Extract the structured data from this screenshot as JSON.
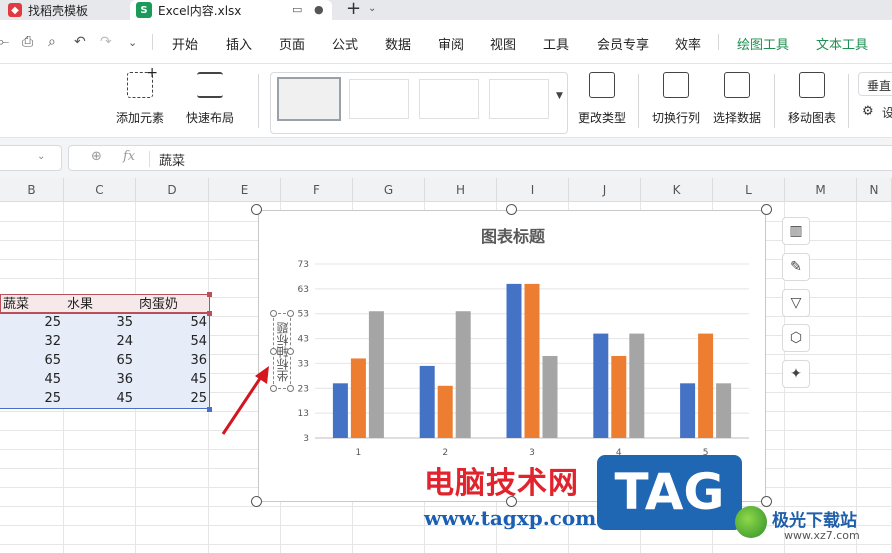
{
  "tabs": {
    "doc_tab": "找稻壳模板",
    "excel_tab": "Excel内容.xlsx"
  },
  "menu": {
    "items": [
      "开始",
      "插入",
      "页面",
      "公式",
      "数据",
      "审阅",
      "视图",
      "工具",
      "会员专享",
      "效率"
    ],
    "context_items": [
      "绘图工具",
      "文本工具"
    ]
  },
  "ribbon": {
    "add_element": "添加元素",
    "quick_layout": "快速布局",
    "change_type": "更改类型",
    "switch_rowcol": "切换行列",
    "select_data": "选择数据",
    "move_chart": "移动图表",
    "cut_right_top": "垂直",
    "cut_right_bottom": "设"
  },
  "formula_bar": {
    "value": "蔬菜"
  },
  "columns": [
    "B",
    "C",
    "D",
    "E",
    "F",
    "G",
    "H",
    "I",
    "J",
    "K",
    "L",
    "M",
    "N"
  ],
  "table": {
    "headers": [
      "蔬菜",
      "水果",
      "肉蛋奶"
    ],
    "rows": [
      [
        25,
        35,
        54
      ],
      [
        32,
        24,
        54
      ],
      [
        65,
        65,
        36
      ],
      [
        45,
        36,
        45
      ],
      [
        25,
        45,
        25
      ]
    ]
  },
  "chart_data": {
    "type": "bar",
    "title": "图表标题",
    "ylabel": "坐标轴标题",
    "categories": [
      "1",
      "2",
      "3",
      "4",
      "5"
    ],
    "series": [
      {
        "values": [
          25,
          32,
          65,
          45,
          25
        ]
      },
      {
        "values": [
          35,
          24,
          65,
          36,
          45
        ]
      },
      {
        "values": [
          54,
          54,
          36,
          45,
          25
        ]
      }
    ],
    "colors": [
      "#4472c4",
      "#ed7d31",
      "#a5a5a5"
    ],
    "yticks": [
      3,
      13,
      23,
      33,
      43,
      53,
      63,
      73
    ],
    "ylim": [
      3,
      73
    ],
    "grid": true
  },
  "watermark": {
    "site_cn": "电脑技术网",
    "site_url": "www.tagxp.com",
    "tag": "TAG",
    "xz_text": "极光下载站",
    "xz_url": "www.xz7.com"
  }
}
